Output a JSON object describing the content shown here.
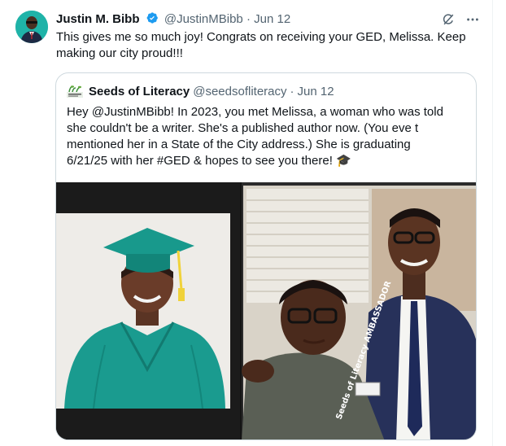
{
  "tweet": {
    "author_name": "Justin M. Bibb",
    "handle": "@JustinMBibb",
    "separator": "·",
    "date": "Jun 12",
    "text": "This gives me so much joy! Congrats on receiving your GED, Melissa. Keep making our city proud!!!",
    "icons": [
      "avatar",
      "verified-badge-icon",
      "grok-icon",
      "more-options-icon"
    ],
    "accent_color": "#1d9bf0"
  },
  "quoted_tweet": {
    "author_name": "Seeds of Literacy",
    "handle": "@seedsofliteracy",
    "separator": "·",
    "date": "Jun 12",
    "text_lines": [
      "Hey @JustinMBibb! In 2023, you met Melissa, a woman who was told",
      "she couldn't be a writer. She's a published author now. (You eve t",
      "mentioned her in a State of the City address.)  She is graduating",
      "6/21/25 with her #GED & hopes to see you there! 🎓"
    ],
    "media": [
      {
        "name": "graduate-photo",
        "description_colors": {
          "gown": "#1a9b8f",
          "background": "#f2f0ec"
        }
      },
      {
        "name": "group-photo",
        "description_colors": {
          "suit": "#27315a",
          "shirt": "#5a5f55"
        }
      },
      {
        "badge_text": "Seeds of Literacy AMBASSADOR"
      }
    ]
  }
}
